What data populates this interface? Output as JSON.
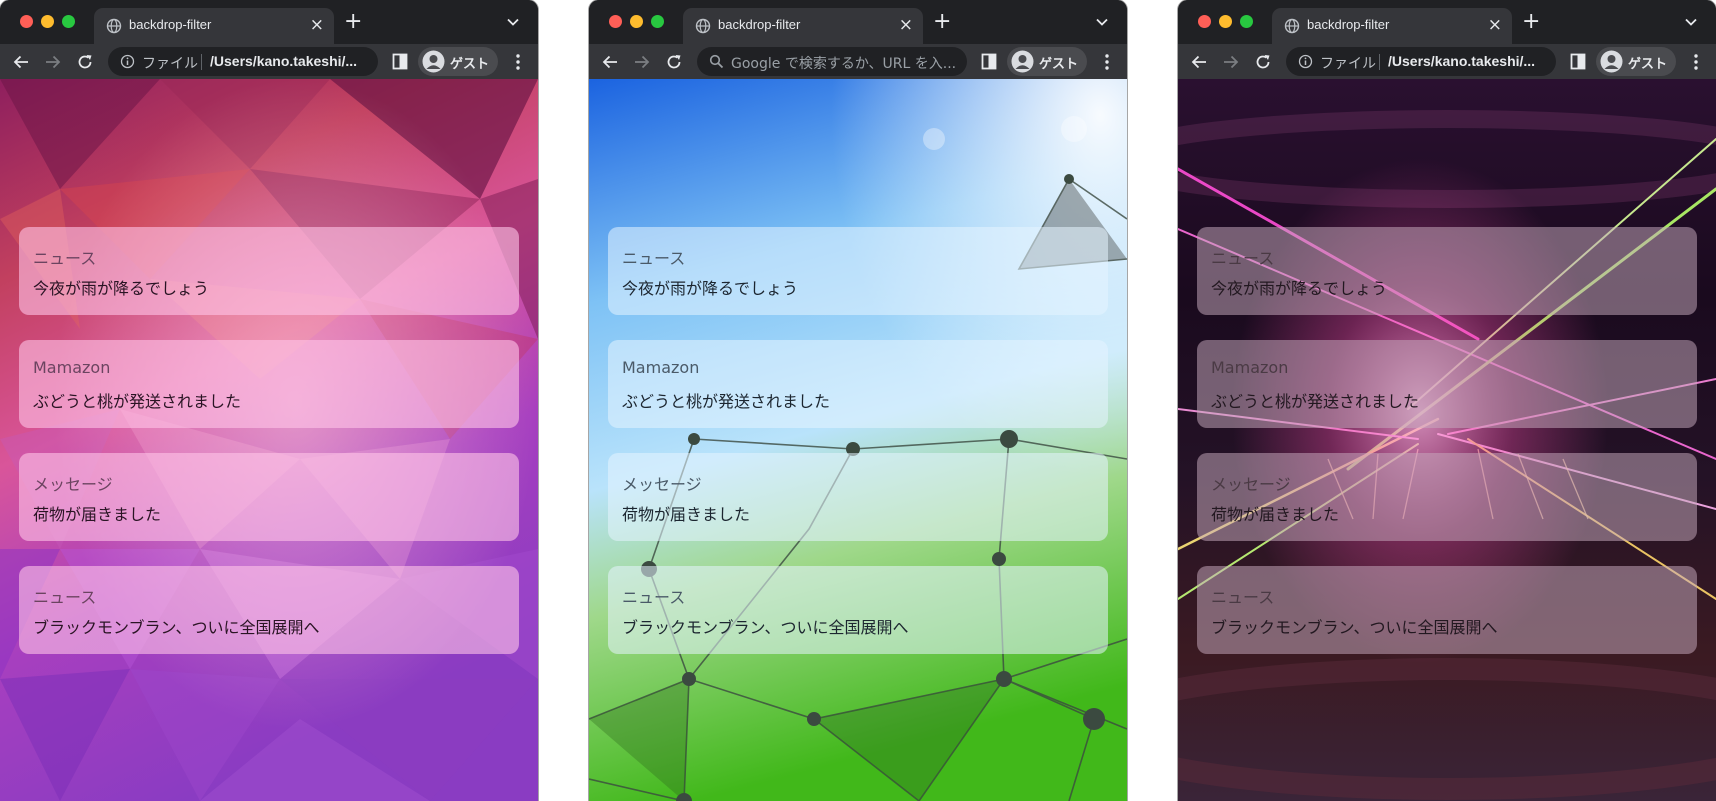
{
  "windows": [
    {
      "tab_title": "backdrop-filter",
      "omnibox": {
        "label": "ファイル",
        "url": "/Users/kano.takeshi/...",
        "placeholder": ""
      },
      "profile_name": "ゲスト",
      "background": "polygon-magenta-purple"
    },
    {
      "tab_title": "backdrop-filter",
      "omnibox": {
        "label": "",
        "url": "",
        "placeholder": "Google で検索するか、URL を入..."
      },
      "profile_name": "ゲスト",
      "background": "network-blue-green"
    },
    {
      "tab_title": "backdrop-filter",
      "omnibox": {
        "label": "ファイル",
        "url": "/Users/kano.takeshi/...",
        "placeholder": ""
      },
      "profile_name": "ゲスト",
      "background": "neon-laser-dark"
    }
  ],
  "notifications": [
    {
      "sender": "ニュース",
      "message": "今夜が雨が降るでしょう"
    },
    {
      "sender": "Mamazon",
      "message": "ぶどうと桃が発送されました"
    },
    {
      "sender": "メッセージ",
      "message": "荷物が届きました"
    },
    {
      "sender": "ニュース",
      "message": "ブラックモンブラン、ついに全国展開へ"
    }
  ],
  "colors": {
    "tabstrip": "#202124",
    "toolbar": "#35363a",
    "traffic_red": "#ff5f57",
    "traffic_yellow": "#febc2e",
    "traffic_green": "#28c840"
  },
  "icons": {
    "tab": "globe-icon",
    "nav": [
      "back-arrow-icon",
      "forward-arrow-icon",
      "reload-icon"
    ],
    "omnibox_file": "info-icon",
    "omnibox_search": "search-icon",
    "toolbar": [
      "side-panel-icon",
      "avatar-icon",
      "kebab-menu-icon"
    ]
  }
}
